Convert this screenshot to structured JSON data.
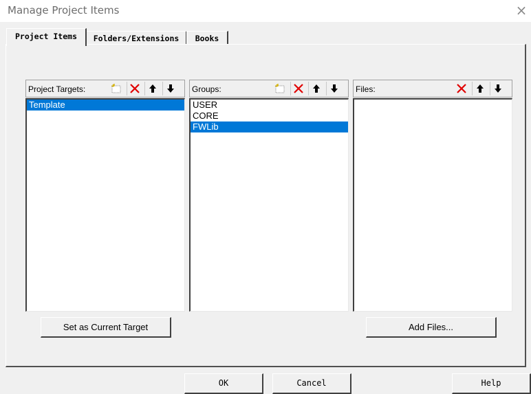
{
  "window": {
    "title": "Manage Project Items",
    "close_glyph": "×"
  },
  "tabs": [
    {
      "label": "Project Items",
      "active": true
    },
    {
      "label": "Folders/Extensions",
      "active": false
    },
    {
      "label": "Books",
      "active": false
    }
  ],
  "panels": {
    "targets": {
      "label": "Project Targets:",
      "tools": [
        "new-icon",
        "delete-icon",
        "move-up-icon",
        "move-down-icon"
      ],
      "items": [
        {
          "text": "Template",
          "selected": true
        }
      ],
      "button_label": "Set as Current Target"
    },
    "groups": {
      "label": "Groups:",
      "tools": [
        "new-icon",
        "delete-icon",
        "move-up-icon",
        "move-down-icon"
      ],
      "items": [
        {
          "text": "USER",
          "selected": false
        },
        {
          "text": "CORE",
          "selected": false
        },
        {
          "text": "FWLib",
          "selected": true
        }
      ]
    },
    "files": {
      "label": "Files:",
      "tools": [
        "delete-icon",
        "move-up-icon",
        "move-down-icon"
      ],
      "items": [],
      "button_label": "Add Files..."
    }
  },
  "dialog_buttons": {
    "ok": "OK",
    "cancel": "Cancel",
    "help": "Help"
  },
  "colors": {
    "selection": "#0078d7",
    "delete_red": "#e00000",
    "face": "#f0f0f0"
  }
}
